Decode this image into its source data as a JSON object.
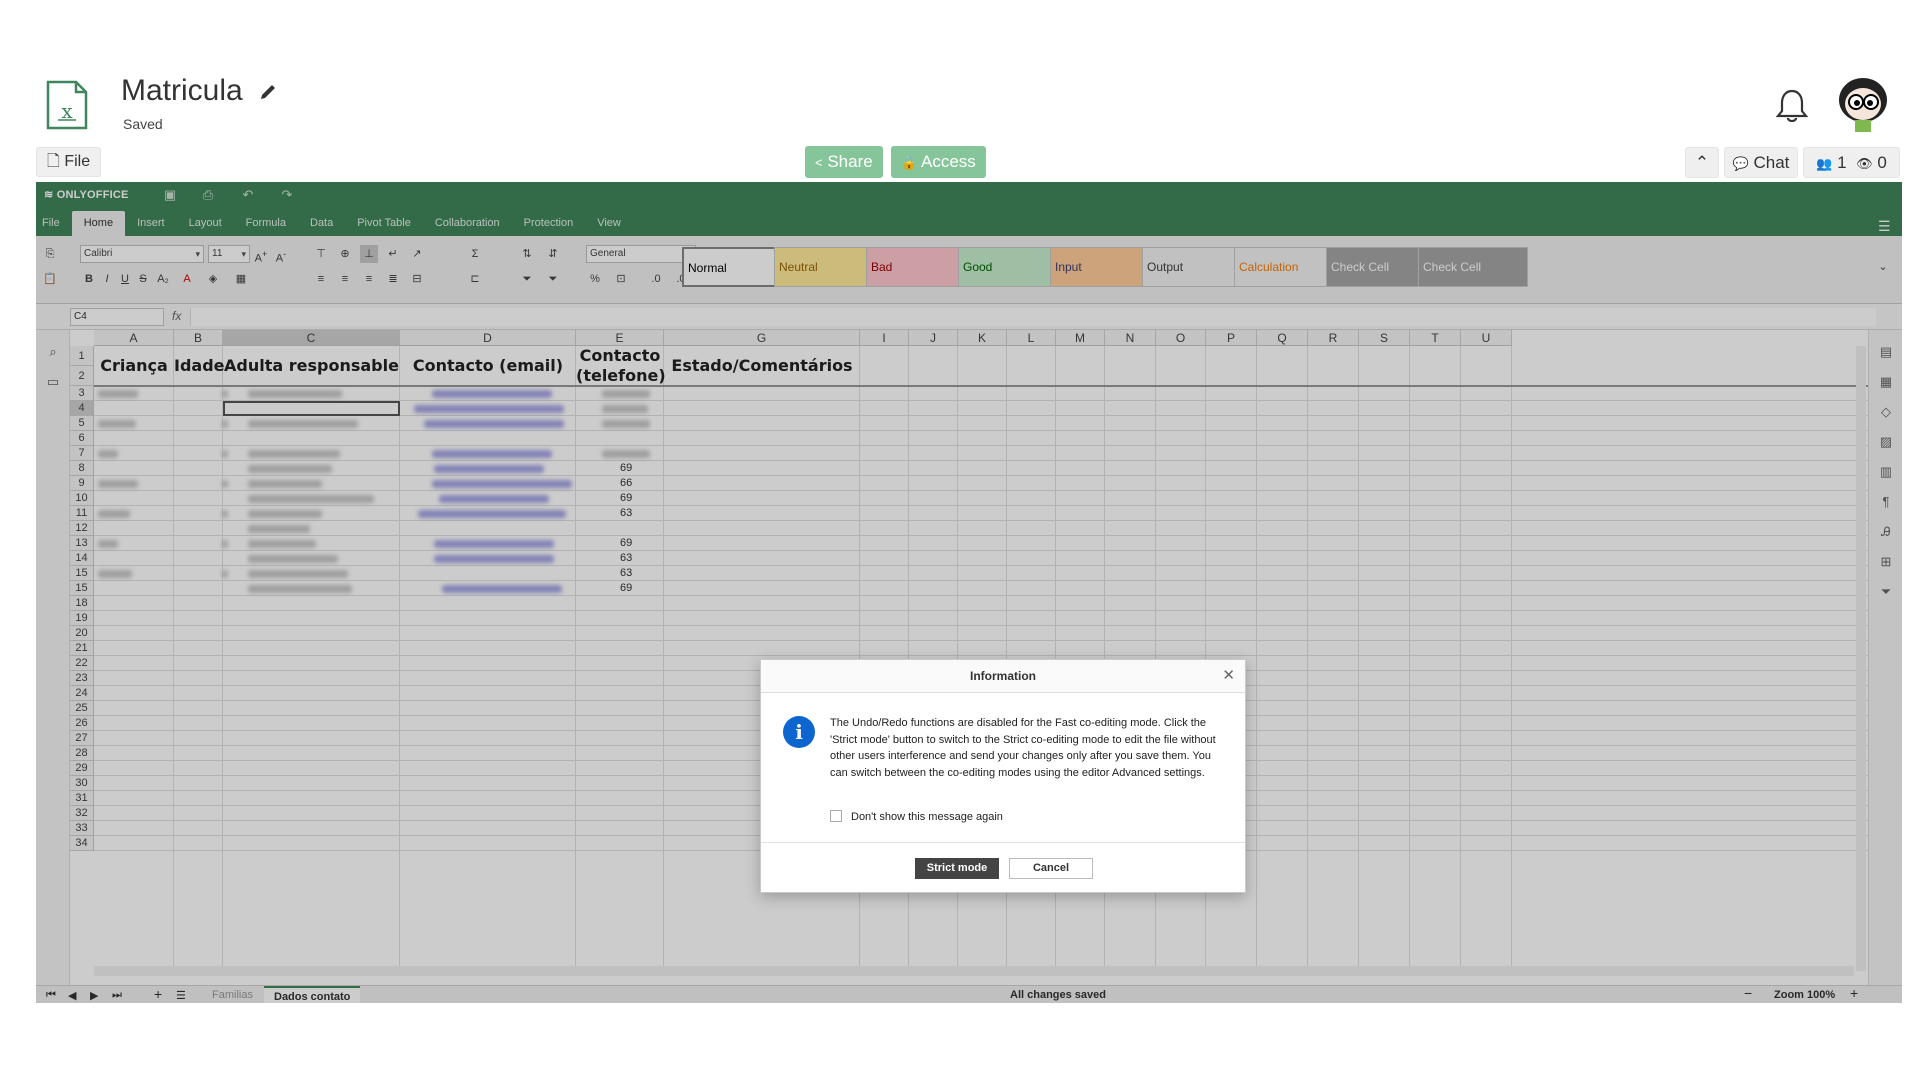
{
  "doc": {
    "title": "Matricula",
    "status": "Saved"
  },
  "toolbar": {
    "file_label": "File",
    "share_label": "Share",
    "access_label": "Access",
    "chat_label": "Chat",
    "users_count": "1",
    "viewers_count": "0"
  },
  "editor": {
    "brand": "ONLYOFFICE",
    "tabs": [
      "File",
      "Home",
      "Insert",
      "Layout",
      "Formula",
      "Data",
      "Pivot Table",
      "Collaboration",
      "Protection",
      "View"
    ],
    "font_name": "Calibri",
    "font_size": "11",
    "number_format": "General",
    "styles": [
      {
        "label": "Normal",
        "bg": "#ffffff",
        "color": "#000000"
      },
      {
        "label": "Neutral",
        "bg": "#ffeb9c",
        "color": "#9c6500"
      },
      {
        "label": "Bad",
        "bg": "#ffc7ce",
        "color": "#9c0006"
      },
      {
        "label": "Good",
        "bg": "#c6efce",
        "color": "#006100"
      },
      {
        "label": "Input",
        "bg": "#ffcc99",
        "color": "#3f3f76"
      },
      {
        "label": "Output",
        "bg": "#f2f2f2",
        "color": "#3f3f3f"
      },
      {
        "label": "Calculation",
        "bg": "#f2f2f2",
        "color": "#fa7d00"
      },
      {
        "label": "Check Cell",
        "bg": "#a5a5a5",
        "color": "#ffffff"
      },
      {
        "label": "Check Cell",
        "bg": "#a5a5a5",
        "color": "#ffffff"
      }
    ],
    "name_box": "C4",
    "fx_label": "fx"
  },
  "sheet": {
    "columns": [
      "A",
      "B",
      "C",
      "D",
      "E",
      "G",
      "I",
      "J",
      "K",
      "L",
      "M",
      "N",
      "O",
      "P",
      "Q",
      "R",
      "S",
      "T",
      "U"
    ],
    "row_numbers": [
      "1",
      "2",
      "3",
      "4",
      "5",
      "6",
      "7",
      "8",
      "9",
      "10",
      "11",
      "12",
      "13",
      "14",
      "15",
      "15",
      "18",
      "19",
      "20",
      "21",
      "22",
      "23",
      "24",
      "25",
      "26",
      "27",
      "28",
      "29",
      "30",
      "31",
      "32",
      "33",
      "34"
    ],
    "headers": {
      "a": "Criança",
      "b": "Idade",
      "c": "Adulta responsable",
      "d": "Contacto (email)",
      "e1": "Contacto",
      "e2": "(telefone)",
      "g": "Estado/Comentários"
    },
    "phone_prefixes": [
      "69",
      "66",
      "69",
      "63",
      "69",
      "63",
      "63",
      "69"
    ]
  },
  "statusbar": {
    "sheet_tabs": [
      "Familias",
      "Dados contato"
    ],
    "status_text": "All changes saved",
    "zoom_label": "Zoom 100%"
  },
  "dialog": {
    "title": "Information",
    "message": "The Undo/Redo functions are disabled for the Fast co-editing mode. Click the 'Strict mode' button to switch to the Strict co-editing mode to edit the file without other users interference and send your changes only after you save them. You can switch between the co-editing modes using the editor Advanced settings.",
    "checkbox_label": "Don't show this message again",
    "primary_button": "Strict mode",
    "secondary_button": "Cancel"
  },
  "colors": {
    "brand_green": "#40865c",
    "share_green": "#86c59a",
    "dialog_info_blue": "#0d66d0"
  }
}
